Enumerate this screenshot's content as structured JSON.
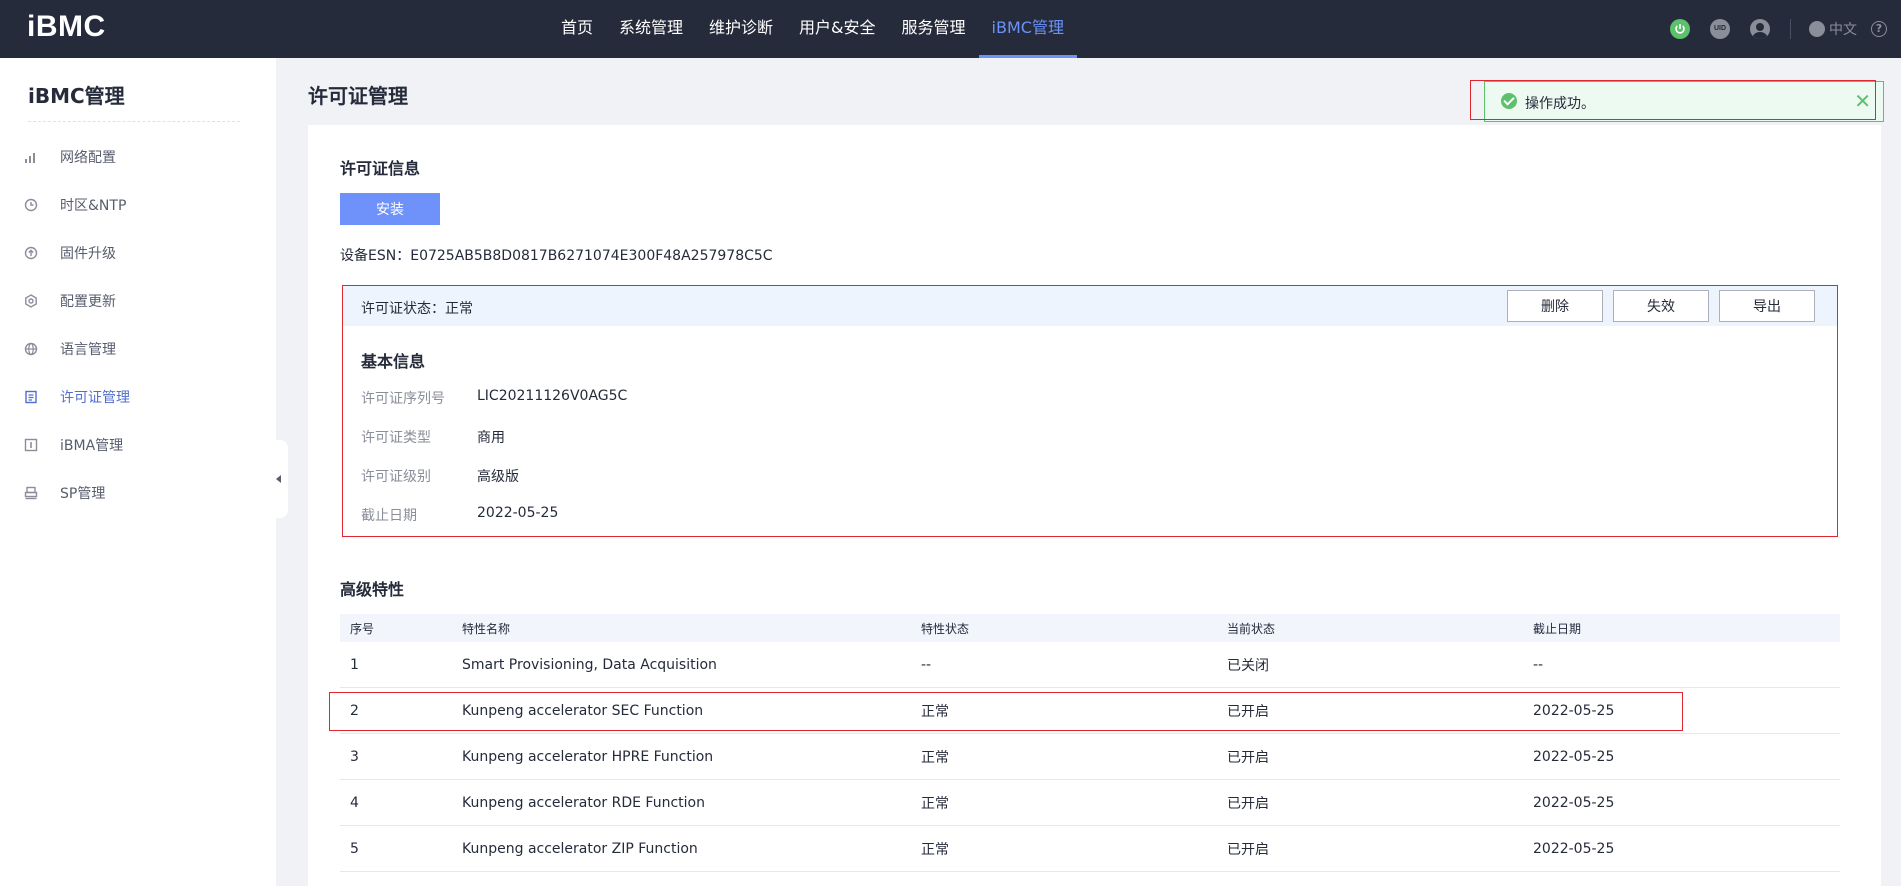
{
  "app": {
    "logo": "iBMC"
  },
  "nav": {
    "items": [
      "首页",
      "系统管理",
      "维护诊断",
      "用户&安全",
      "服务管理",
      "iBMC管理"
    ],
    "active_index": 5
  },
  "topbar": {
    "uid_label": "UID",
    "lang_label": "中文",
    "help_label": "?"
  },
  "sidebar": {
    "title": "iBMC管理",
    "items": [
      {
        "label": "网络配置",
        "icon": "bar-chart-icon"
      },
      {
        "label": "时区&NTP",
        "icon": "clock-icon"
      },
      {
        "label": "固件升级",
        "icon": "upload-icon"
      },
      {
        "label": "配置更新",
        "icon": "gear-icon"
      },
      {
        "label": "语言管理",
        "icon": "globe-icon"
      },
      {
        "label": "许可证管理",
        "icon": "document-icon"
      },
      {
        "label": "iBMA管理",
        "icon": "info-icon"
      },
      {
        "label": "SP管理",
        "icon": "printer-icon"
      }
    ],
    "active_index": 5
  },
  "page": {
    "title": "许可证管理"
  },
  "license_info": {
    "section_title": "许可证信息",
    "install_label": "安装",
    "esn_label": "设备ESN：",
    "esn_value": "E0725AB5B8D0817B6271074E300F48A257978C5C",
    "status_label": "许可证状态：",
    "status_value": "正常",
    "buttons": {
      "delete": "删除",
      "invalidate": "失效",
      "export": "导出"
    },
    "basic_title": "基本信息",
    "fields": [
      {
        "label": "许可证序列号",
        "value": "LIC20211126V0AG5C"
      },
      {
        "label": "许可证类型",
        "value": "商用"
      },
      {
        "label": "许可证级别",
        "value": "高级版"
      },
      {
        "label": "截止日期",
        "value": "2022-05-25"
      }
    ]
  },
  "advanced": {
    "section_title": "高级特性",
    "headers": [
      "序号",
      "特性名称",
      "特性状态",
      "当前状态",
      "截止日期"
    ],
    "rows": [
      [
        "1",
        "Smart Provisioning, Data Acquisition",
        "--",
        "已关闭",
        "--"
      ],
      [
        "2",
        "Kunpeng accelerator SEC Function",
        "正常",
        "已开启",
        "2022-05-25"
      ],
      [
        "3",
        "Kunpeng accelerator HPRE Function",
        "正常",
        "已开启",
        "2022-05-25"
      ],
      [
        "4",
        "Kunpeng accelerator RDE Function",
        "正常",
        "已开启",
        "2022-05-25"
      ],
      [
        "5",
        "Kunpeng accelerator ZIP Function",
        "正常",
        "已开启",
        "2022-05-25"
      ]
    ]
  },
  "toast": {
    "message": "操作成功。",
    "close": "✕"
  },
  "colors": {
    "accent": "#6c92fa",
    "topbar_bg": "#252b3a",
    "success": "#5bc16a",
    "annotation": "#e0262e"
  }
}
